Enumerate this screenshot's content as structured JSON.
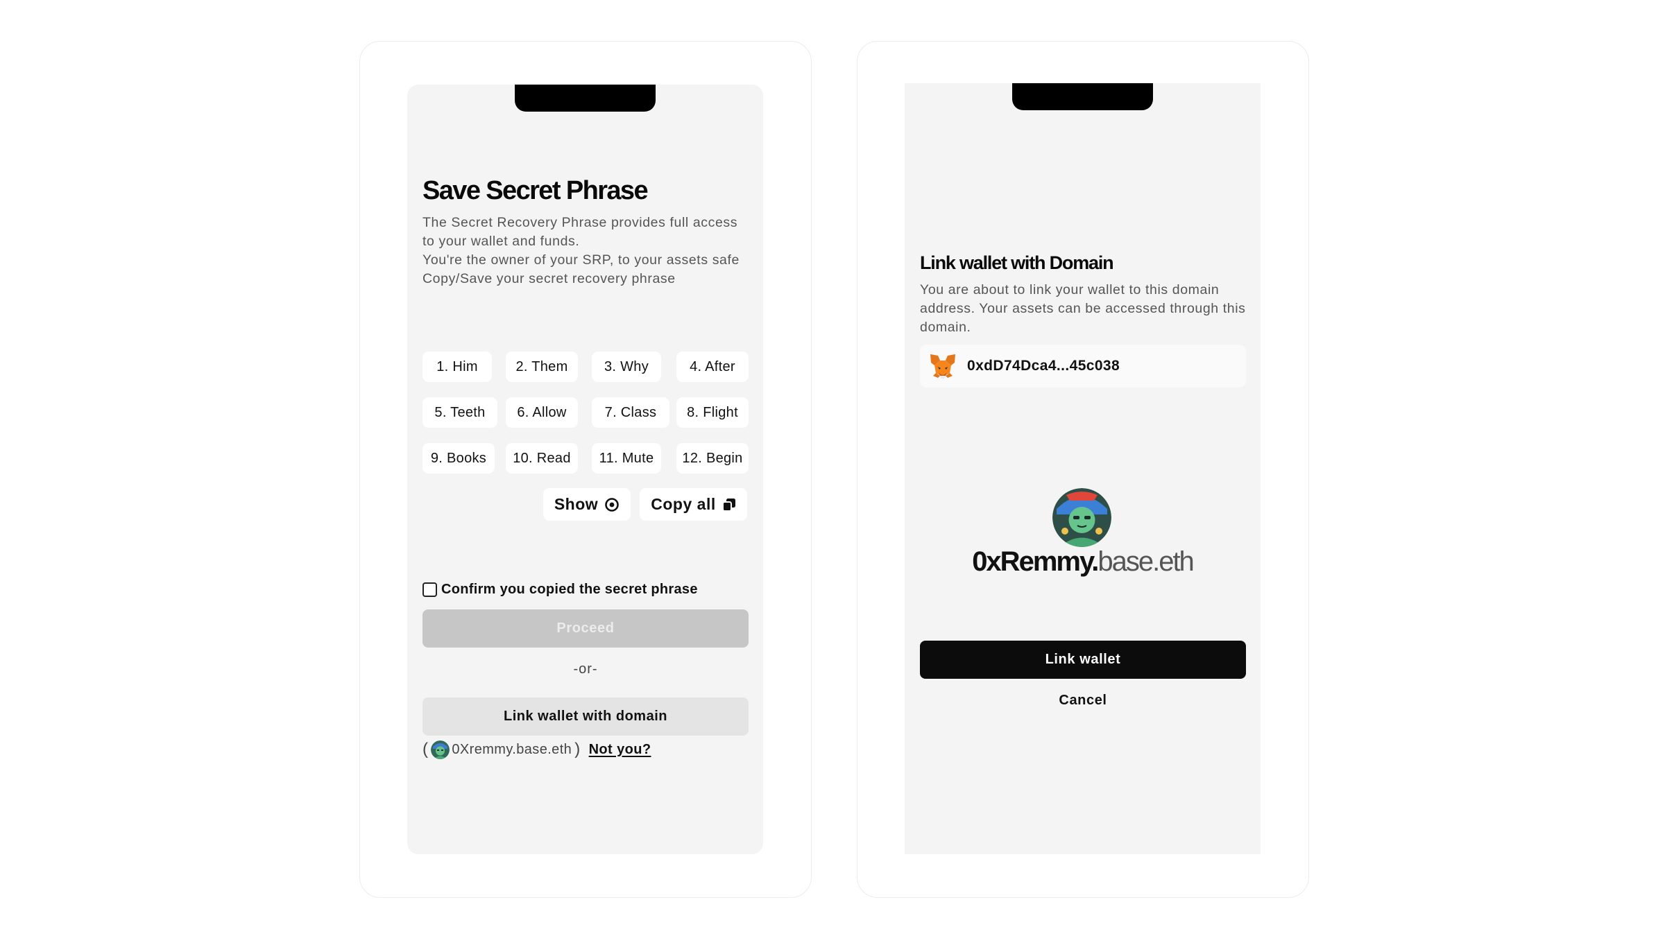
{
  "left_screen": {
    "title": "Save Secret Phrase",
    "description": [
      "The Secret Recovery Phrase provides full access to your wallet and funds.",
      "You're the owner of your SRP, to your assets safe Copy/Save your secret recovery phrase"
    ],
    "words": [
      "1. Him",
      "2. Them",
      "3. Why",
      "4. After",
      "5. Teeth",
      "6. Allow",
      "7. Class",
      "8. Flight",
      "9. Books",
      "10. Read",
      "11. Mute",
      "12. Begin"
    ],
    "show_label": "Show",
    "copy_label": "Copy all",
    "confirm_label": "Confirm you copied the secret phrase",
    "proceed_label": "Proceed",
    "or_label": "-or-",
    "link_domain_label": "Link wallet with domain",
    "identity": {
      "open_paren": "(",
      "domain": "0Xremmy.base.eth",
      "close_paren": ")",
      "not_you_label": "Not you?"
    }
  },
  "right_screen": {
    "title": "Link wallet with Domain",
    "description": "You are about to link your wallet to this domain address. Your assets can be accessed through this domain.",
    "wallet_icon": "metamask-fox-icon",
    "wallet_address": "0xdD74Dca4...45c038",
    "domain_handle": "0xRemmy.",
    "domain_suffix": "base.eth",
    "link_wallet_label": "Link wallet",
    "cancel_label": "Cancel"
  },
  "colors": {
    "screen_bg": "#f4f4f4",
    "primary_button": "#0c0c0c",
    "disabled_button": "#c6c6c6",
    "secondary_button": "#e4e4e4"
  }
}
